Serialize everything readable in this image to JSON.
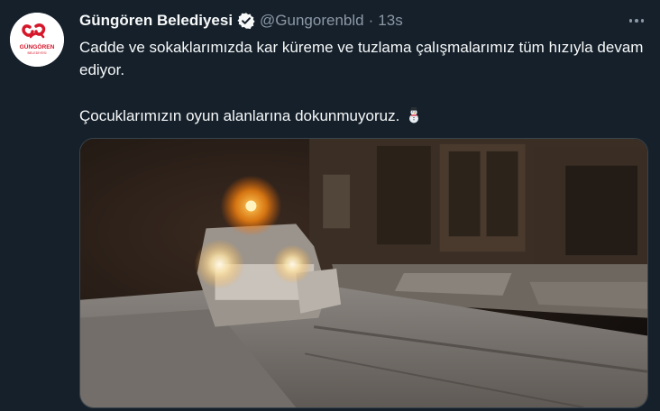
{
  "account": {
    "display_name": "Güngören Belediyesi",
    "handle": "@Gungorenbld",
    "separator": "·",
    "timestamp": "13s",
    "verified": true,
    "logo_text": "GÜNGÖREN",
    "logo_subtext": "BELEDİYESİ"
  },
  "tweet": {
    "line1": "Cadde ve sokaklarımızda kar küreme ve tuzlama çalışmalarımız tüm hızıyla devam ediyor.",
    "line2": "Çocuklarımızın oyun alanlarına dokunmuyoruz.",
    "emoji": "snowman-emoji"
  },
  "colors": {
    "background": "#15202b",
    "primary_text": "#f7f9f9",
    "secondary_text": "#8b98a5",
    "verified_badge": "#f7f9f9",
    "logo_red": "#d6172a"
  },
  "icons": {
    "verified": "verified-badge-icon",
    "more": "more-options-icon"
  }
}
